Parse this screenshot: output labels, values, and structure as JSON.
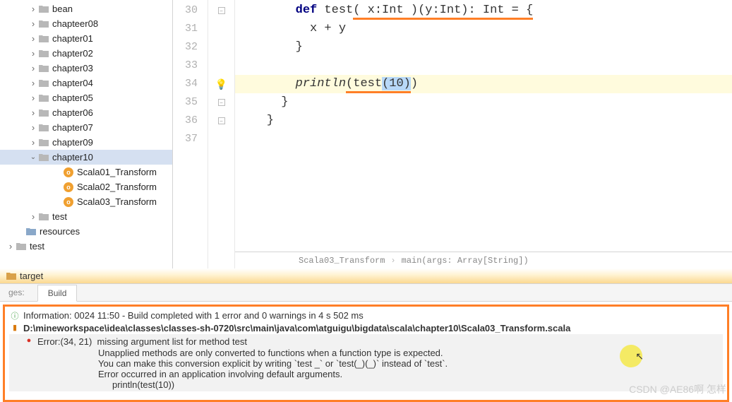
{
  "sidebar": {
    "items": [
      {
        "label": "bean",
        "indent": "ind-0",
        "chev": "closed",
        "icon": "folder"
      },
      {
        "label": "chapteer08",
        "indent": "ind-0",
        "chev": "closed",
        "icon": "folder"
      },
      {
        "label": "chapter01",
        "indent": "ind-0",
        "chev": "closed",
        "icon": "folder"
      },
      {
        "label": "chapter02",
        "indent": "ind-0",
        "chev": "closed",
        "icon": "folder"
      },
      {
        "label": "chapter03",
        "indent": "ind-0",
        "chev": "closed",
        "icon": "folder"
      },
      {
        "label": "chapter04",
        "indent": "ind-0",
        "chev": "closed",
        "icon": "folder"
      },
      {
        "label": "chapter05",
        "indent": "ind-0",
        "chev": "closed",
        "icon": "folder"
      },
      {
        "label": "chapter06",
        "indent": "ind-0",
        "chev": "closed",
        "icon": "folder"
      },
      {
        "label": "chapter07",
        "indent": "ind-0",
        "chev": "closed",
        "icon": "folder"
      },
      {
        "label": "chapter09",
        "indent": "ind-0",
        "chev": "closed",
        "icon": "folder"
      },
      {
        "label": "chapter10",
        "indent": "ind-0",
        "chev": "open",
        "icon": "folder",
        "selected": true
      },
      {
        "label": "Scala01_Transform",
        "indent": "ind-2",
        "icon": "scala"
      },
      {
        "label": "Scala02_Transform",
        "indent": "ind-2",
        "icon": "scala"
      },
      {
        "label": "Scala03_Transform",
        "indent": "ind-2",
        "icon": "scala"
      },
      {
        "label": "test",
        "indent": "ind-0",
        "chev": "closed",
        "icon": "folder"
      },
      {
        "label": "resources",
        "indent": "ind-neg1",
        "icon": "folder-res"
      },
      {
        "label": "test",
        "indent": "ind-neg2",
        "chev": "closed",
        "icon": "folder"
      },
      {
        "label": "target",
        "indent": "ind-neg3",
        "icon": "folder-target"
      }
    ]
  },
  "editor": {
    "startLine": 30,
    "lines": [
      "30",
      "31",
      "32",
      "33",
      "34",
      "35",
      "36",
      "37"
    ],
    "code": {
      "l30": {
        "indent": "        ",
        "kw": "def",
        "fn": " test",
        "params": "( x:Int )(y:Int): Int = {"
      },
      "l31": {
        "text": "          x + y"
      },
      "l32": {
        "text": "        }"
      },
      "l33": {
        "text": ""
      },
      "l34": {
        "indent": "        ",
        "fn": "println",
        "open": "(test",
        "arg": "(10)",
        "close": ")"
      },
      "l35": {
        "text": "      }"
      },
      "l36": {
        "text": "    }"
      },
      "l37": {
        "text": ""
      }
    }
  },
  "breadcrumb": {
    "a": "Scala03_Transform",
    "b": "main(args: Array[String])"
  },
  "tabs": {
    "left": "ges:",
    "build": "Build"
  },
  "messages": {
    "info": "Information: 0024 11:50 - Build completed with 1 error and 0 warnings in 4 s 502 ms",
    "file": "D:\\mineworkspace\\idea\\classes\\classes-sh-0720\\src\\main\\java\\com\\atguigu\\bigdata\\scala\\chapter10\\Scala03_Transform.scala",
    "err_loc": "Error:(34, 21)",
    "err_msg": "missing argument list for method test",
    "err_d1": "Unapplied methods are only converted to functions when a function type is expected.",
    "err_d2": "You can make this conversion explicit by writing `test _` or `test(_)(_)` instead of `test`.",
    "err_d3": "Error occurred in an application involving default arguments.",
    "err_d4": "println(test(10))"
  },
  "watermark": "CSDN @AE86啊 怎样"
}
